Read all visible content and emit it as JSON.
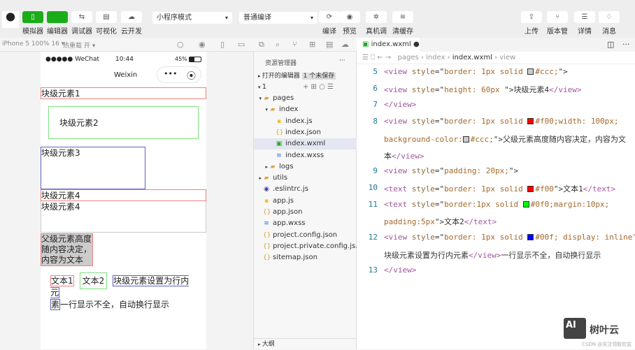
{
  "toolbar": {
    "left_buttons": [
      {
        "label": "模拟器",
        "icon": "phone-icon"
      },
      {
        "label": "编辑器",
        "icon": "code-icon"
      },
      {
        "label": "调试器",
        "icon": "swap-icon"
      },
      {
        "label": "可视化",
        "icon": "layout-icon"
      },
      {
        "label": "云开发",
        "icon": "cloud-icon"
      }
    ],
    "mode_select": "小程序模式",
    "compile_select": "普通编译",
    "mid_buttons": [
      {
        "label": "编译",
        "icon": "refresh-icon"
      },
      {
        "label": "预览",
        "icon": "eye-icon"
      },
      {
        "label": "真机调试",
        "icon": "bug-icon"
      },
      {
        "label": "清缓存",
        "icon": "layers-icon"
      }
    ],
    "right_buttons": [
      {
        "label": "上传",
        "icon": "upload-icon"
      },
      {
        "label": "版本管理",
        "icon": "branch-icon"
      },
      {
        "label": "详情",
        "icon": "menu-icon"
      },
      {
        "label": "消息",
        "icon": "bell-icon"
      }
    ]
  },
  "subbar": {
    "device": "iPhone 5 100% 16 ▾",
    "hot_reload": "热重载 开 ▾"
  },
  "phone": {
    "signal": "●●●●● WeChat",
    "time": "10:44",
    "battery": "45%",
    "nav_title": "Weixin",
    "blocks": [
      "块级元素1",
      "块级元素2",
      "块级元素3",
      "块级元素4",
      "块级元素4",
      "父级元素高度随内容决定，内容为文本"
    ],
    "inline": {
      "text1": "文本1",
      "text2": "文本2",
      "view_text_a": "块级元素设置为行内元",
      "view_text_b": "素",
      "tail": "一行显示不全，自动换行显示"
    }
  },
  "explorer": {
    "title": "资源管理器",
    "more": "···",
    "open_editors": "打开的编辑器",
    "unsaved": "1 个未保存",
    "root": "1",
    "files": [
      {
        "name": "pages",
        "type": "folder"
      },
      {
        "name": "index",
        "type": "folder"
      },
      {
        "name": "index.js",
        "type": "js"
      },
      {
        "name": "index.json",
        "type": "json"
      },
      {
        "name": "index.wxml",
        "type": "wxml"
      },
      {
        "name": "index.wxss",
        "type": "wxss"
      },
      {
        "name": "logs",
        "type": "folder"
      },
      {
        "name": "utils",
        "type": "folder"
      },
      {
        "name": ".eslintrc.js",
        "type": "eslint"
      },
      {
        "name": "app.js",
        "type": "js"
      },
      {
        "name": "app.json",
        "type": "json"
      },
      {
        "name": "app.wxss",
        "type": "wxss"
      },
      {
        "name": "project.config.json",
        "type": "json"
      },
      {
        "name": "project.private.config.js...",
        "type": "json"
      },
      {
        "name": "sitemap.json",
        "type": "json"
      }
    ],
    "outline": "大纲"
  },
  "editor": {
    "tab": "index.wxml",
    "breadcrumb": [
      "pages",
      "index",
      "index.wxml",
      "view"
    ],
    "lines": [
      {
        "n": "5",
        "code": [
          [
            "t",
            "<view "
          ],
          [
            "a",
            "style"
          ],
          [
            "o",
            "=\""
          ],
          [
            "s",
            "border: 1px solid "
          ],
          [
            "sw",
            "#cccccc"
          ],
          [
            "s",
            "#ccc;"
          ],
          [
            "o",
            "\">"
          ]
        ]
      },
      {
        "n": "6",
        "code": [
          [
            "t",
            "<view "
          ],
          [
            "a",
            "style"
          ],
          [
            "o",
            "=\""
          ],
          [
            "s",
            "height: 60px "
          ],
          [
            "o",
            "\">块级元素4"
          ],
          [
            "t",
            "</view>"
          ]
        ]
      },
      {
        "n": "7",
        "code": [
          [
            "t",
            "</view>"
          ]
        ]
      },
      {
        "n": "8",
        "code": [
          [
            "t",
            "<view "
          ],
          [
            "a",
            "style"
          ],
          [
            "o",
            "=\""
          ],
          [
            "s",
            "border: 1px solid "
          ],
          [
            "sw",
            "#ff0000"
          ],
          [
            "s",
            "#f00;width: 100px;"
          ]
        ]
      },
      {
        "n": "",
        "code": [
          [
            "s",
            "background-color:"
          ],
          [
            "sw",
            "#cccccc"
          ],
          [
            "s",
            "#ccc;"
          ],
          [
            "o",
            "\">父级元素高度随内容决定，内容为文"
          ]
        ]
      },
      {
        "n": "",
        "code": [
          [
            "o",
            "本"
          ],
          [
            "t",
            "</view>"
          ]
        ]
      },
      {
        "n": "9",
        "code": [
          [
            "t",
            "<view "
          ],
          [
            "a",
            "style"
          ],
          [
            "o",
            "=\""
          ],
          [
            "s",
            "padding: 20px;"
          ],
          [
            "o",
            "\">"
          ]
        ]
      },
      {
        "n": "10",
        "code": [
          [
            "t",
            "<text "
          ],
          [
            "a",
            "style"
          ],
          [
            "o",
            "=\""
          ],
          [
            "s",
            "border: 1px solid "
          ],
          [
            "sw",
            "#ff0000"
          ],
          [
            "s",
            "#f00"
          ],
          [
            "o",
            "\">文本1"
          ],
          [
            "t",
            "</text>"
          ]
        ]
      },
      {
        "n": "11",
        "code": [
          [
            "t",
            "<text "
          ],
          [
            "a",
            "style"
          ],
          [
            "o",
            "=\""
          ],
          [
            "s",
            "border:1px solid "
          ],
          [
            "sw",
            "#00ff00"
          ],
          [
            "s",
            "#0f0;margin:10px;"
          ]
        ]
      },
      {
        "n": "",
        "code": [
          [
            "s",
            "padding:5px"
          ],
          [
            "o",
            "\">文本2"
          ],
          [
            "t",
            "</text>"
          ]
        ]
      },
      {
        "n": "12",
        "code": [
          [
            "t",
            "<view "
          ],
          [
            "a",
            "style"
          ],
          [
            "o",
            "=\""
          ],
          [
            "s",
            "border: 1px solid "
          ],
          [
            "sw",
            "#0000ff"
          ],
          [
            "s",
            "#00f; display: inline\""
          ]
        ]
      },
      {
        "n": "",
        "code": [
          [
            "o",
            "块级元素设置为行内元素"
          ],
          [
            "t",
            "</view>"
          ],
          [
            "o",
            "一行显示不全，自动换行显示"
          ]
        ]
      },
      {
        "n": "13",
        "code": [
          [
            "t",
            "</view>"
          ]
        ]
      }
    ]
  },
  "watermark": {
    "brand": "树叶云",
    "note": "CSDN @关注领取钦盆"
  },
  "colors": {
    "accent": "#1aad19",
    "red": "#ff0000",
    "green": "#00ff00",
    "blue": "#0000ff"
  }
}
